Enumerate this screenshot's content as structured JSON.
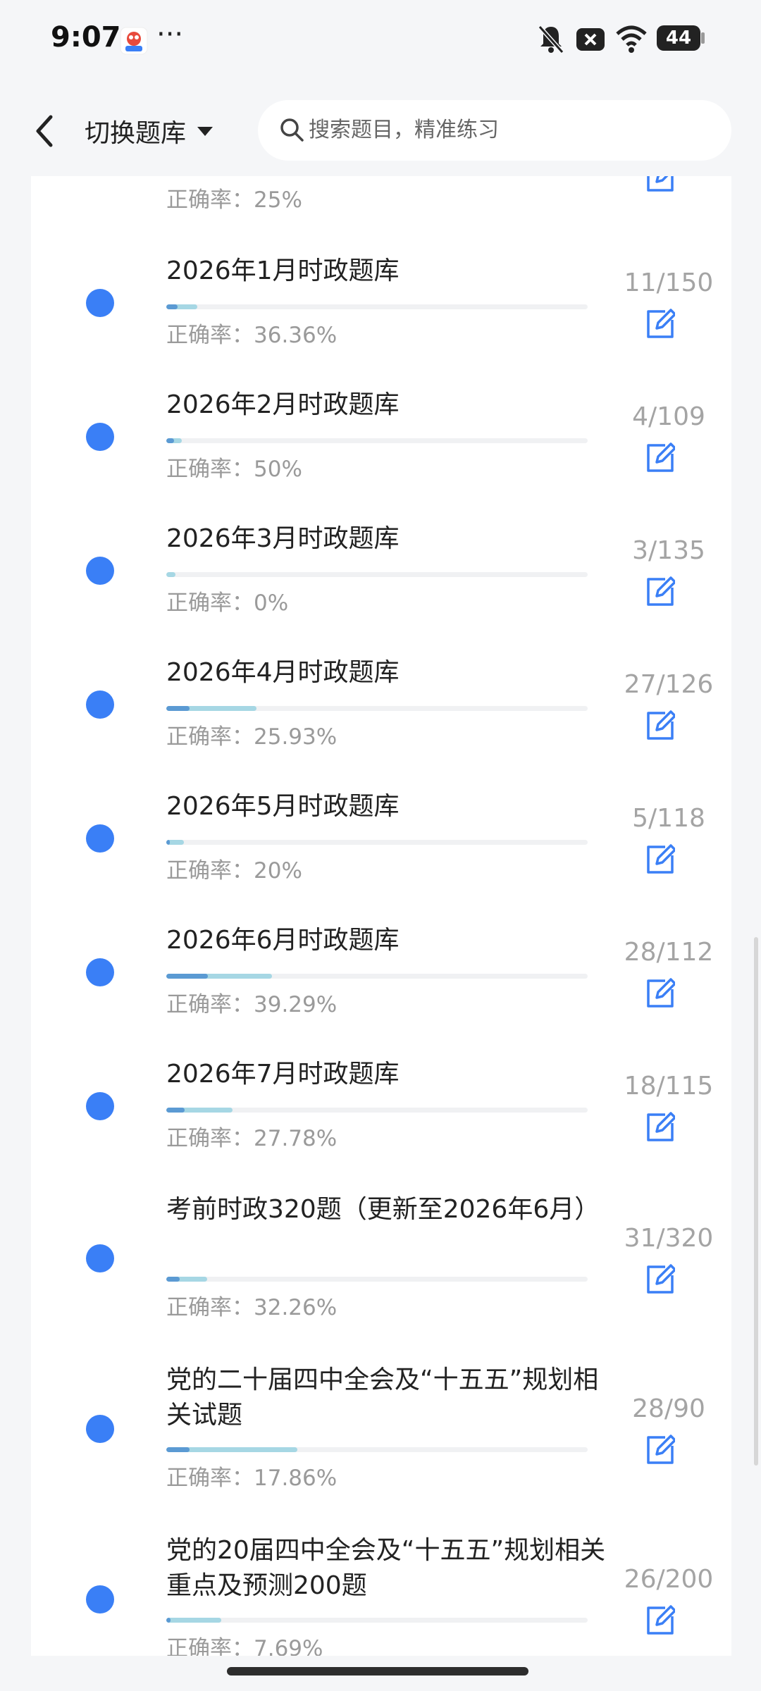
{
  "status_bar": {
    "time": "9:07",
    "more": "···",
    "battery": "44"
  },
  "header": {
    "switch_label": "切换题库",
    "search_placeholder": "搜索题目，精准练习"
  },
  "list": {
    "partial_item": {
      "accuracy": "正确率：25%"
    },
    "items": [
      {
        "title": "2026年1月时政题库",
        "count": "11/150",
        "accuracy": "正确率：36.36%",
        "progress": 0.0733,
        "correct_rate": 0.3636
      },
      {
        "title": "2026年2月时政题库",
        "count": "4/109",
        "accuracy": "正确率：50%",
        "progress": 0.0367,
        "correct_rate": 0.5
      },
      {
        "title": "2026年3月时政题库",
        "count": "3/135",
        "accuracy": "正确率：0%",
        "progress": 0.0222,
        "correct_rate": 0.0
      },
      {
        "title": "2026年4月时政题库",
        "count": "27/126",
        "accuracy": "正确率：25.93%",
        "progress": 0.2143,
        "correct_rate": 0.2593
      },
      {
        "title": "2026年5月时政题库",
        "count": "5/118",
        "accuracy": "正确率：20%",
        "progress": 0.0424,
        "correct_rate": 0.2
      },
      {
        "title": "2026年6月时政题库",
        "count": "28/112",
        "accuracy": "正确率：39.29%",
        "progress": 0.25,
        "correct_rate": 0.3929
      },
      {
        "title": "2026年7月时政题库",
        "count": "18/115",
        "accuracy": "正确率：27.78%",
        "progress": 0.1565,
        "correct_rate": 0.2778
      },
      {
        "title": "考前时政320题（更新至2026年6月）",
        "count": "31/320",
        "accuracy": "正确率：32.26%",
        "progress": 0.0969,
        "correct_rate": 0.3226
      },
      {
        "title": "党的二十届四中全会及“十五五”规划相关试题",
        "count": "28/90",
        "accuracy": "正确率：17.86%",
        "progress": 0.3111,
        "correct_rate": 0.1786
      },
      {
        "title": "党的20届四中全会及“十五五”规划相关重点及预测200题",
        "count": "26/200",
        "accuracy": "正确率：7.69%",
        "progress": 0.13,
        "correct_rate": 0.0769
      }
    ]
  },
  "colors": {
    "accent_dot": "#3a7ff6",
    "edit_icon": "#3a7ff6",
    "progress_light": "#a6d7e4",
    "progress_dark": "#5b9ad3"
  }
}
